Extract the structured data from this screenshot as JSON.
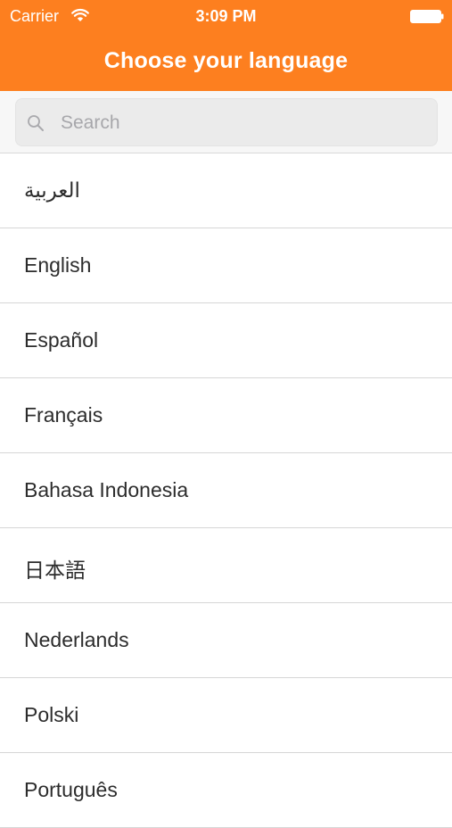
{
  "status_bar": {
    "carrier": "Carrier",
    "time": "3:09 PM",
    "wifi_icon": "wifi-icon",
    "battery_icon": "battery-icon"
  },
  "header": {
    "title": "Choose your language",
    "background_color": "#fd7f1f"
  },
  "search": {
    "placeholder": "Search",
    "value": "",
    "icon": "search-icon"
  },
  "languages": [
    {
      "label": "العربية"
    },
    {
      "label": "English"
    },
    {
      "label": "Español"
    },
    {
      "label": "Français"
    },
    {
      "label": "Bahasa Indonesia"
    },
    {
      "label": "日本語"
    },
    {
      "label": "Nederlands"
    },
    {
      "label": "Polski"
    },
    {
      "label": "Português"
    }
  ]
}
